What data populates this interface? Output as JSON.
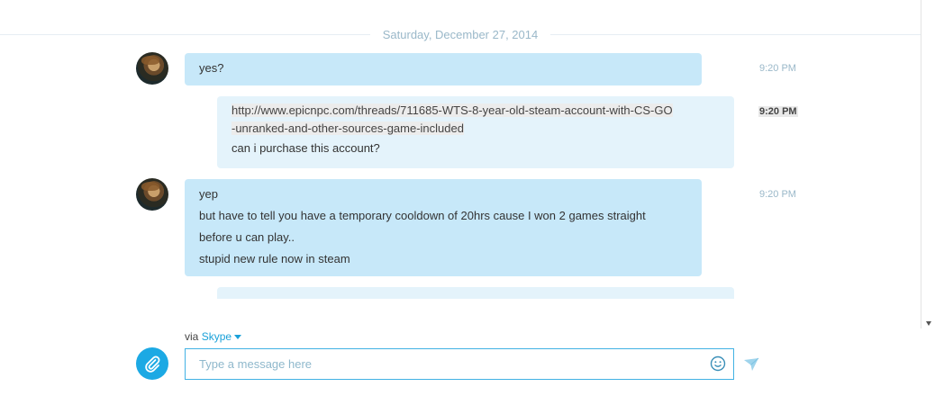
{
  "conversation": {
    "date_label": "Saturday, December 27, 2014",
    "messages": [
      {
        "sender": "them",
        "time": "9:20 PM",
        "lines": [
          "yes?"
        ]
      },
      {
        "sender": "me",
        "time": "9:20 PM",
        "link_lines": [
          "http://www.epicnpc.com/threads/711685-WTS-8-year-old-steam-account-with-CS-GO",
          "-unranked-and-other-sources-game-included"
        ],
        "lines": [
          "can i purchase this account?"
        ]
      },
      {
        "sender": "them",
        "time": "9:20 PM",
        "lines": [
          "yep",
          "but have to tell you have a temporary cooldown of 20hrs cause I won 2 games straight",
          "before u can play..",
          "stupid new rule now in steam"
        ]
      }
    ]
  },
  "composer": {
    "via_prefix": "via",
    "service": "Skype",
    "placeholder": "Type a message here"
  },
  "icons": {
    "attach": "paperclip-icon",
    "emoji": "emoji-icon",
    "send": "send-icon",
    "scroll_down": "scroll-down-arrow-icon"
  },
  "colors": {
    "incoming_bubble": "#c7e8f9",
    "outgoing_bubble": "#e4f3fb",
    "accent": "#1ca9e4",
    "timestamp": "#9ab8c9"
  }
}
